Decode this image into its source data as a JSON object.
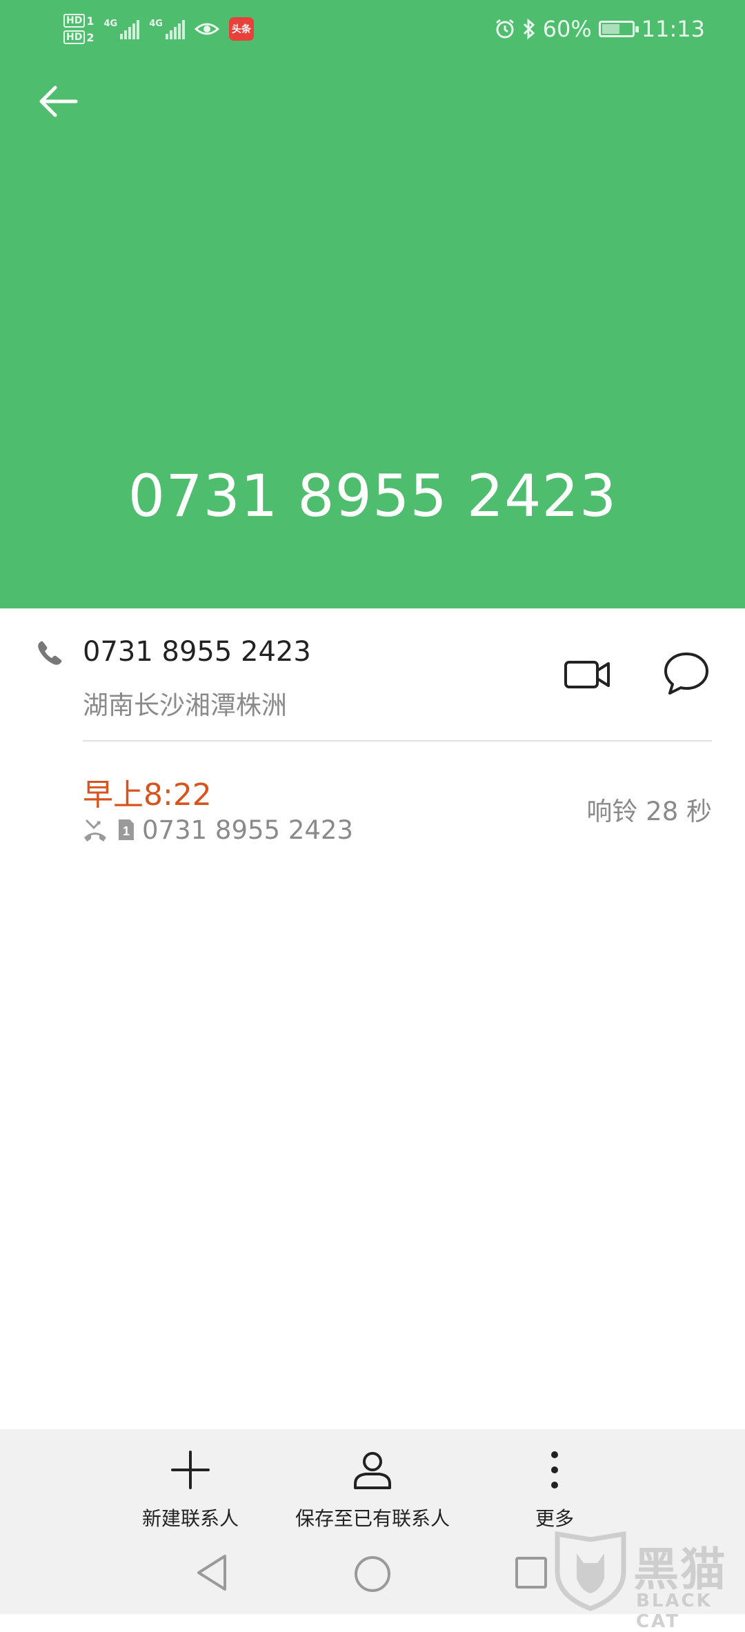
{
  "status_bar": {
    "sim1_label": "HD",
    "sim1_index": "1",
    "sim2_label": "HD",
    "sim2_index": "2",
    "network1": "4G",
    "network2": "4G",
    "app_badge": "头条",
    "battery_percent": "60%",
    "battery_level": 0.6,
    "time": "11:13"
  },
  "header": {
    "phone_number": "0731 8955 2423",
    "color": "#4fbd6e"
  },
  "contact_row": {
    "number": "0731 8955 2423",
    "location": "湖南长沙湘潭株洲"
  },
  "call_log": {
    "time": "早上8:22",
    "number": "0731 8955 2423",
    "duration": "响铃 28 秒",
    "sim_index": "1",
    "accent_color": "#d8541f"
  },
  "actions": {
    "new_contact": "新建联系人",
    "save_existing": "保存至已有联系人",
    "more": "更多"
  },
  "watermark": {
    "brand": "黑猫",
    "brand_en": "BLACK CAT"
  }
}
